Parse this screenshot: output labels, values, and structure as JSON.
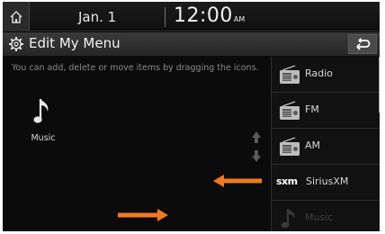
{
  "status": {
    "date": "Jan.  1",
    "time": "12:00",
    "ampm": "AM"
  },
  "title": {
    "text": "Edit My Menu"
  },
  "main": {
    "hint": "You can add, delete or move items by dragging the icons.",
    "music_tile_label": "Music"
  },
  "menu": {
    "items": [
      {
        "label": "Radio",
        "icon": "radio-icon"
      },
      {
        "label": "FM",
        "icon": "radio-icon"
      },
      {
        "label": "AM",
        "icon": "radio-icon"
      },
      {
        "label": "SiriusXM",
        "icon_text": "sxm",
        "icon": "siriusxm-logo"
      },
      {
        "label": "Music",
        "icon": "music-note-icon",
        "dimmed": true
      }
    ]
  },
  "colors": {
    "accent_arrow": "#f07a1e",
    "background": "#0b0b0b",
    "text": "#d6d6d6"
  }
}
